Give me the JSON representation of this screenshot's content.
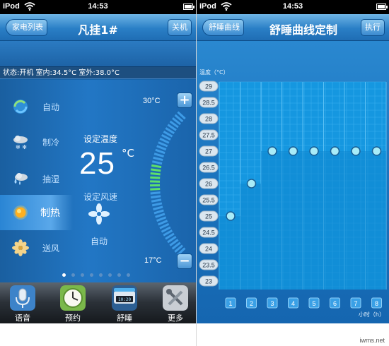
{
  "left": {
    "status_bar": {
      "carrier": "iPod",
      "time": "14:53"
    },
    "nav": {
      "back_label": "家电列表",
      "title": "凡挂1#",
      "right_label": "关机"
    },
    "info": {
      "text": "状态:开机 室内:34.5°C 室外:38.0°C"
    },
    "modes": [
      {
        "label": "自动",
        "icon": "auto-mode-icon",
        "active": false
      },
      {
        "label": "制冷",
        "icon": "snowflake-cloud-icon",
        "active": false
      },
      {
        "label": "抽湿",
        "icon": "droplet-cloud-icon",
        "active": false
      },
      {
        "label": "制热",
        "icon": "sun-icon",
        "active": true
      },
      {
        "label": "送风",
        "icon": "fan-flower-icon",
        "active": false
      }
    ],
    "set_temp_label": "设定温度",
    "temperature": "25",
    "temp_unit": "°C",
    "fan_speed_label": "设定风速",
    "fan_speed_value": "自动",
    "max_temp": "30°C",
    "min_temp": "17°C",
    "plus_symbol": "+",
    "minus_symbol": "−",
    "page_dots": {
      "count": 8,
      "active_index": 0
    },
    "tabs": [
      {
        "label": "语音",
        "icon": "microphone-icon"
      },
      {
        "label": "预约",
        "icon": "clock-icon"
      },
      {
        "label": "舒睡",
        "icon": "sleep-icon"
      },
      {
        "label": "更多",
        "icon": "tools-icon"
      }
    ]
  },
  "right": {
    "status_bar": {
      "carrier": "iPod",
      "time": "14:53"
    },
    "nav": {
      "back_label": "舒睡曲线",
      "title": "舒睡曲线定制",
      "right_label": "执行"
    }
  },
  "chart_data": {
    "type": "line",
    "ylabel": "温度（°C）",
    "xlabel": "小时（h）",
    "y_ticks": [
      "29",
      "28.5",
      "28",
      "27.5",
      "27",
      "26.5",
      "26",
      "25.5",
      "25",
      "24.5",
      "24",
      "23.5",
      "23"
    ],
    "ylim": [
      23,
      29
    ],
    "x": [
      1,
      2,
      3,
      4,
      5,
      6,
      7,
      8
    ],
    "series": [
      {
        "values": [
          25,
          26,
          27,
          27,
          27,
          27,
          27,
          27
        ]
      }
    ],
    "grid": true,
    "colors": {
      "grid_fill": "#1597e0",
      "grid_line": "#5cc0f4",
      "point": "#a8ecf8"
    }
  },
  "watermark": "iwms.net"
}
